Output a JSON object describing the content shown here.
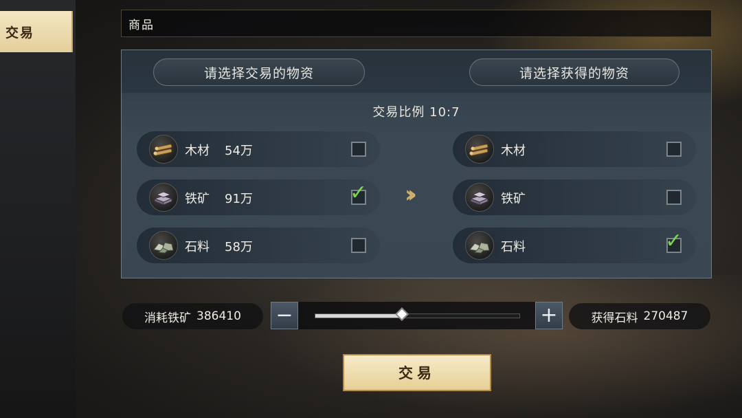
{
  "sidebar": {
    "tab_label": "交易"
  },
  "header": {
    "title": "商品"
  },
  "panel": {
    "left_header": "请选择交易的物资",
    "right_header": "请选择获得的物资",
    "ratio_label": "交易比例",
    "ratio_value": "10:7",
    "give_items": [
      {
        "name": "木材",
        "amount": "54万",
        "icon": "wood-icon",
        "checked": false
      },
      {
        "name": "铁矿",
        "amount": "91万",
        "icon": "iron-ore-icon",
        "checked": true
      },
      {
        "name": "石料",
        "amount": "58万",
        "icon": "stone-icon",
        "checked": false
      }
    ],
    "get_items": [
      {
        "name": "木材",
        "icon": "wood-icon",
        "checked": false
      },
      {
        "name": "铁矿",
        "icon": "iron-ore-icon",
        "checked": false
      },
      {
        "name": "石料",
        "icon": "stone-icon",
        "checked": true
      }
    ],
    "arrow_icon": "double-chevron-right-icon"
  },
  "exchange": {
    "consume_label": "消耗铁矿",
    "consume_value": "386410",
    "gain_label": "获得石料",
    "gain_value": "270487",
    "slider_fraction": 0.425,
    "minus_symbol": "−",
    "plus_symbol": "+"
  },
  "trade_button": {
    "label": "交易"
  },
  "colors": {
    "check": "#7ed64c",
    "gold": "#e6cf96",
    "panel": "#3b4955"
  }
}
